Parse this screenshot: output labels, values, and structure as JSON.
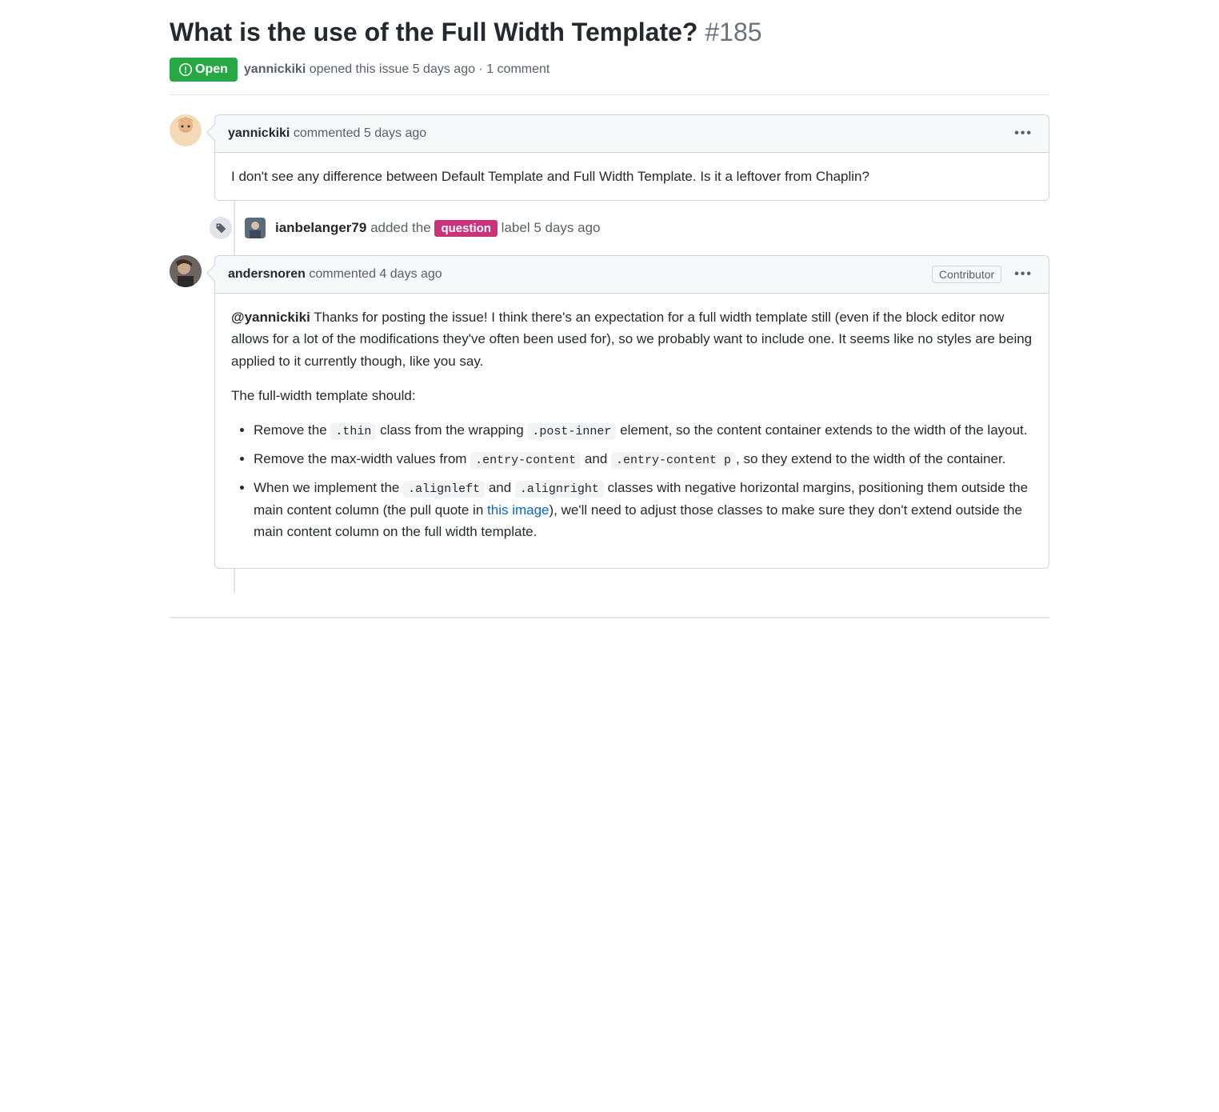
{
  "issue": {
    "title": "What is the use of the Full Width Template?",
    "number": "#185",
    "state": "Open",
    "author": "yannickiki",
    "opened_action": "opened this issue",
    "opened_time": "5 days ago",
    "comment_count": "1 comment"
  },
  "comments": [
    {
      "author": "yannickiki",
      "action": "commented",
      "time": "5 days ago",
      "role": "",
      "body_p1": "I don't see any difference between Default Template and Full Width Template. Is it a leftover from Chaplin?"
    },
    {
      "author": "andersnoren",
      "action": "commented",
      "time": "4 days ago",
      "role": "Contributor",
      "mention": "@yannickiki",
      "body_p1_rest": " Thanks for posting the issue! I think there's an expectation for a full width template still (even if the block editor now allows for a lot of the modifications they've often been used for), so we probably want to include one. It seems like no styles are being applied to it currently though, like you say.",
      "body_p2": "The full-width template should:",
      "li1_a": "Remove the ",
      "li1_code1": ".thin",
      "li1_b": " class from the wrapping ",
      "li1_code2": ".post-inner",
      "li1_c": " element, so the content container extends to the width of the layout.",
      "li2_a": "Remove the max-width values from ",
      "li2_code1": ".entry-content",
      "li2_b": " and ",
      "li2_code2": ".entry-content p",
      "li2_c": ", so they extend to the width of the container.",
      "li3_a": "When we implement the ",
      "li3_code1": ".alignleft",
      "li3_b": " and ",
      "li3_code2": ".alignright",
      "li3_c": " classes with negative horizontal margins, positioning them outside the main content column (the pull quote in ",
      "li3_link": "this image",
      "li3_d": "), we'll need to adjust those classes to make sure they don't extend outside the main content column on the full width template."
    }
  ],
  "event": {
    "author": "ianbelanger79",
    "action_pre": "added the",
    "label": "question",
    "action_post": "label",
    "time": "5 days ago"
  }
}
